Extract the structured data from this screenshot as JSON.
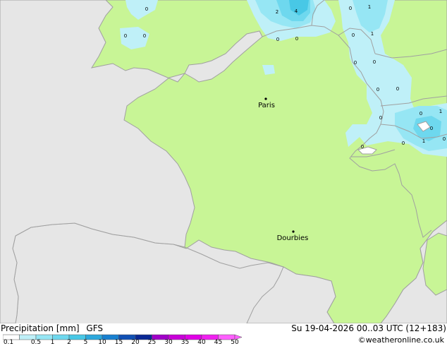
{
  "footer": {
    "title": "Precipitation [mm]",
    "model": "GFS",
    "datetime": "Su 19-04-2026 00..03 UTC (12+183)",
    "credit": "©weatheronline.co.uk"
  },
  "legend": {
    "labels": [
      "0.1",
      "0.5",
      "1",
      "2",
      "5",
      "10",
      "15",
      "20",
      "25",
      "30",
      "35",
      "40",
      "45",
      "50"
    ],
    "colors": [
      "#ffffff",
      "#bff0f8",
      "#96e6f4",
      "#6ed8ee",
      "#48c8e6",
      "#2ca8dc",
      "#1880d0",
      "#1050b4",
      "#0a2894",
      "#a000c8",
      "#c800d8",
      "#e000e6",
      "#f020f0",
      "#ff60ff"
    ]
  },
  "map": {
    "cities": [
      {
        "name": "Paris"
      },
      {
        "name": "Dourbies"
      }
    ],
    "precip_values": [
      {
        "value": "0"
      },
      {
        "value": "2"
      },
      {
        "value": "4"
      },
      {
        "value": "0"
      },
      {
        "value": "1"
      },
      {
        "value": "0"
      },
      {
        "value": "0"
      },
      {
        "value": "0"
      },
      {
        "value": "0"
      },
      {
        "value": "0"
      },
      {
        "value": "1"
      },
      {
        "value": "0"
      },
      {
        "value": "0"
      },
      {
        "value": "0"
      },
      {
        "value": "0"
      },
      {
        "value": "0"
      },
      {
        "value": "0"
      },
      {
        "value": "1"
      },
      {
        "value": "0"
      },
      {
        "value": "0"
      },
      {
        "value": "1"
      },
      {
        "value": "0"
      },
      {
        "value": "0"
      }
    ],
    "colors": {
      "sea": "#e6e6e6",
      "land": "#c8f596",
      "coast": "#a0a0a0"
    }
  }
}
